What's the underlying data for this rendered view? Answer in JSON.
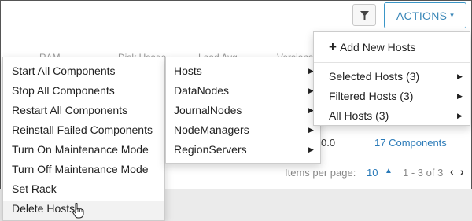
{
  "toolbar": {
    "filter_icon": "filter-icon",
    "actions_label": "ACTIONS",
    "actions_caret": "▾"
  },
  "table": {
    "headers": [
      "RAM",
      "Disk Usage",
      "Load Avg",
      "Versions"
    ],
    "row": {
      "value_partial": "0.0",
      "components_link": "17 Components"
    }
  },
  "pager": {
    "label": "Items per page:",
    "per_page": "10",
    "range": "1 - 3 of 3"
  },
  "actions_menu": {
    "add_new_hosts": "Add New Hosts",
    "items": [
      {
        "label": "Selected Hosts (3)"
      },
      {
        "label": "Filtered Hosts (3)"
      },
      {
        "label": "All Hosts (3)"
      }
    ]
  },
  "submenu_components": {
    "items": [
      {
        "label": "Hosts"
      },
      {
        "label": "DataNodes"
      },
      {
        "label": "JournalNodes"
      },
      {
        "label": "NodeManagers"
      },
      {
        "label": "RegionServers"
      }
    ]
  },
  "submenu_operations": {
    "items": [
      {
        "label": "Start All Components"
      },
      {
        "label": "Stop All Components"
      },
      {
        "label": "Restart All Components"
      },
      {
        "label": "Reinstall Failed Components"
      },
      {
        "label": "Turn On Maintenance Mode"
      },
      {
        "label": "Turn Off Maintenance Mode"
      },
      {
        "label": "Set Rack"
      },
      {
        "label": "Delete Hosts"
      }
    ]
  },
  "colors": {
    "accent": "#3a87b8",
    "link": "#2a7ab8",
    "band": "#ebebeb"
  }
}
